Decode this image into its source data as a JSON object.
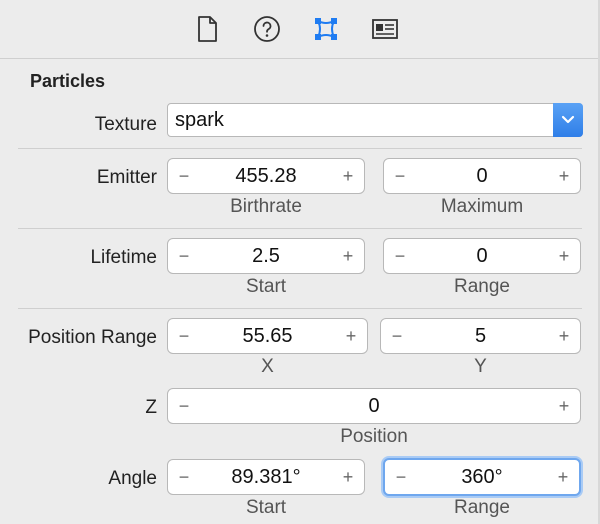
{
  "toolbar": {
    "tabs": [
      {
        "icon": "file-icon"
      },
      {
        "icon": "help-icon"
      },
      {
        "icon": "attributes-inspector-icon",
        "active": true
      },
      {
        "icon": "size-inspector-icon"
      }
    ],
    "active_color": "#1f7cf2"
  },
  "section": {
    "title": "Particles"
  },
  "texture": {
    "label": "Texture",
    "value": "spark"
  },
  "emitter": {
    "label": "Emitter",
    "birthrate": {
      "value": "455.28",
      "label": "Birthrate"
    },
    "maximum": {
      "value": "0",
      "label": "Maximum"
    }
  },
  "lifetime": {
    "label": "Lifetime",
    "start": {
      "value": "2.5",
      "label": "Start"
    },
    "range": {
      "value": "0",
      "label": "Range"
    }
  },
  "position_range": {
    "label": "Position Range",
    "x": {
      "value": "55.65",
      "label": "X"
    },
    "y": {
      "value": "5",
      "label": "Y"
    },
    "z_label": "Z",
    "z": {
      "value": "0",
      "label": "Position"
    }
  },
  "angle": {
    "label": "Angle",
    "start": {
      "value": "89.381°",
      "label": "Start"
    },
    "range": {
      "value": "360°",
      "label": "Range"
    }
  },
  "stepper": {
    "minus": "−",
    "plus": "+"
  }
}
